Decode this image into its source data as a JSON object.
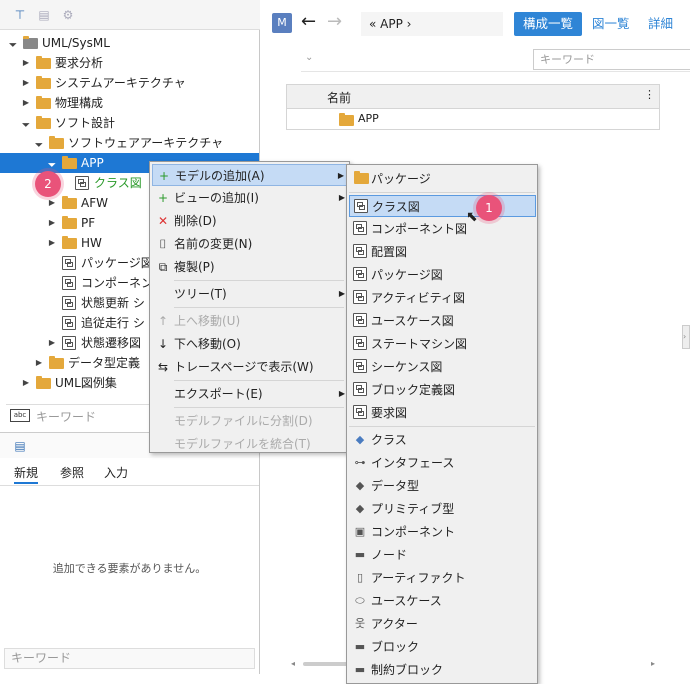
{
  "left_toolbar": {
    "icons": [
      "model-tree-icon",
      "list-icon",
      "settings-icon"
    ]
  },
  "tree": [
    {
      "label": "UML/SysML",
      "level": 0,
      "expanded": true,
      "icon": "folder-root"
    },
    {
      "label": "要求分析",
      "level": 1,
      "expanded": false,
      "icon": "folder"
    },
    {
      "label": "システムアーキテクチャ",
      "level": 1,
      "expanded": false,
      "icon": "folder"
    },
    {
      "label": "物理構成",
      "level": 1,
      "expanded": false,
      "icon": "folder"
    },
    {
      "label": "ソフト設計",
      "level": 1,
      "expanded": true,
      "icon": "folder"
    },
    {
      "label": "ソフトウェアアーキテクチャ",
      "level": 2,
      "expanded": true,
      "icon": "folder"
    },
    {
      "label": "APP",
      "level": 3,
      "expanded": true,
      "icon": "folder",
      "selected": true
    },
    {
      "label": "クラス図",
      "level": 4,
      "icon": "diagram",
      "green": true
    },
    {
      "label": "AFW",
      "level": 3,
      "expanded": false,
      "icon": "folder"
    },
    {
      "label": "PF",
      "level": 3,
      "expanded": false,
      "icon": "folder"
    },
    {
      "label": "HW",
      "level": 3,
      "expanded": false,
      "icon": "folder"
    },
    {
      "label": "パッケージ図",
      "level": 3,
      "icon": "diagram"
    },
    {
      "label": "コンポーネント図",
      "level": 3,
      "icon": "diagram"
    },
    {
      "label": "状態更新 シ",
      "level": 3,
      "icon": "diagram"
    },
    {
      "label": "追従走行 シ",
      "level": 3,
      "icon": "diagram"
    },
    {
      "label": "状態遷移図",
      "level": 3,
      "expanded": false,
      "icon": "diagram"
    },
    {
      "label": "データ型定義",
      "level": 2,
      "expanded": false,
      "icon": "folder"
    },
    {
      "label": "UML図例集",
      "level": 1,
      "expanded": false,
      "icon": "folder"
    }
  ],
  "tree_search": {
    "placeholder": "キーワード",
    "icon": "abc"
  },
  "palette": {
    "tabs": [
      "新規",
      "参照",
      "入力"
    ],
    "empty_message": "追加できる要素がありません。",
    "keyword_placeholder": "キーワード"
  },
  "right": {
    "m_button": "M",
    "back": "←",
    "forward": "→",
    "breadcrumb": "« APP ›",
    "view_list": "構成一覧",
    "view_diagram": "図一覧",
    "view_detail": "詳細",
    "keyword_placeholder": "キーワード",
    "grid_header": "名前",
    "grid_rows": [
      "APP"
    ]
  },
  "context_menu": [
    {
      "label": "モデルの追加(A)",
      "icon": "+",
      "submenu": true,
      "highlight": true
    },
    {
      "label": "ビューの追加(I)",
      "icon": "+",
      "submenu": true
    },
    {
      "label": "削除(D)",
      "icon": "✕"
    },
    {
      "label": "名前の変更(N)",
      "icon": "⌷"
    },
    {
      "label": "複製(P)",
      "icon": "⧉"
    },
    {
      "label": "ツリー(T)",
      "submenu": true
    },
    {
      "label": "上へ移動(U)",
      "icon": "↑",
      "disabled": true
    },
    {
      "label": "下へ移動(O)",
      "icon": "↓"
    },
    {
      "label": "トレースページで表示(W)",
      "icon": "⇆"
    },
    {
      "label": "エクスポート(E)",
      "submenu": true
    },
    {
      "label": "モデルファイルに分割(D)",
      "disabled": true
    },
    {
      "label": "モデルファイルを統合(T)",
      "disabled": true
    }
  ],
  "submenu": [
    {
      "label": "パッケージ",
      "icon": "folder"
    },
    {
      "label": "クラス図",
      "icon": "diagram",
      "highlight": true
    },
    {
      "label": "コンポーネント図",
      "icon": "diagram"
    },
    {
      "label": "配置図",
      "icon": "diagram"
    },
    {
      "label": "パッケージ図",
      "icon": "diagram"
    },
    {
      "label": "アクティビティ図",
      "icon": "diagram"
    },
    {
      "label": "ユースケース図",
      "icon": "diagram"
    },
    {
      "label": "ステートマシン図",
      "icon": "diagram"
    },
    {
      "label": "シーケンス図",
      "icon": "diagram"
    },
    {
      "label": "ブロック定義図",
      "icon": "diagram"
    },
    {
      "label": "要求図",
      "icon": "diagram"
    },
    {
      "label": "クラス",
      "icon": "class"
    },
    {
      "label": "インタフェース",
      "icon": "interface"
    },
    {
      "label": "データ型",
      "icon": "datatype"
    },
    {
      "label": "プリミティブ型",
      "icon": "primitive"
    },
    {
      "label": "コンポーネント",
      "icon": "component"
    },
    {
      "label": "ノード",
      "icon": "node"
    },
    {
      "label": "アーティファクト",
      "icon": "artifact"
    },
    {
      "label": "ユースケース",
      "icon": "usecase"
    },
    {
      "label": "アクター",
      "icon": "actor"
    },
    {
      "label": "ブロック",
      "icon": "block"
    },
    {
      "label": "制約ブロック",
      "icon": "constraint"
    }
  ],
  "badges": {
    "one": "1",
    "two": "2"
  },
  "colors": {
    "selection": "#1e78d4",
    "folder": "#e4a83b",
    "badge": "#e9537a",
    "menu_highlight": "#c5dbf5"
  }
}
